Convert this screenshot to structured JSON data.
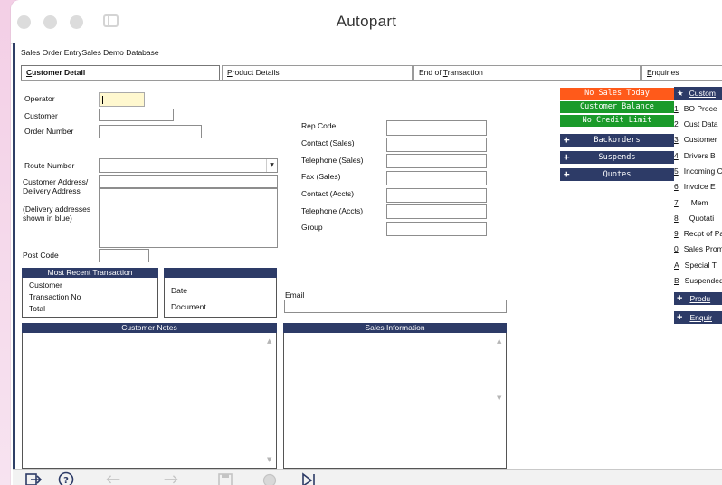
{
  "window": {
    "title": "Autopart"
  },
  "breadcrumb": {
    "text": "Sales Order EntrySales Demo Database"
  },
  "tabs": [
    {
      "label": "Customer Detail",
      "accel": "C",
      "rest": "ustomer Detail"
    },
    {
      "label": "Product Details",
      "pre": "",
      "accel": "P",
      "rest": "roduct Details"
    },
    {
      "label": "End of Transaction",
      "pre": "End of ",
      "accel": "T",
      "rest": "ransaction"
    },
    {
      "label": "Enquiries",
      "accel": "E",
      "rest": "nquiries"
    }
  ],
  "form": {
    "operator": "Operator",
    "customer": "Customer",
    "order_number": "Order Number",
    "route_number": "Route Number",
    "customer_address": "Customer Address/",
    "delivery_address": "Delivery Address",
    "delivery_note_1": "(Delivery addresses",
    "delivery_note_2": "shown in blue)",
    "post_code": "Post Code",
    "rep_code": "Rep Code",
    "contact_sales": "Contact (Sales)",
    "telephone_sales": "Telephone (Sales)",
    "fax_sales": "Fax (Sales)",
    "contact_accts": "Contact (Accts)",
    "telephone_accts": "Telephone (Accts)",
    "group": "Group",
    "email": "Email"
  },
  "recent": {
    "title": "Most Recent Transaction",
    "customer": "Customer",
    "transaction_no": "Transaction No",
    "total": "Total",
    "date": "Date",
    "document": "Document"
  },
  "panels": {
    "customer_notes": "Customer Notes",
    "sales_information": "Sales Information"
  },
  "status": {
    "no_sales": "No Sales Today",
    "customer_balance": "Customer Balance",
    "no_credit": "No Credit Limit"
  },
  "actions": {
    "backorders": "Backorders",
    "suspends": "Suspends",
    "quotes": "Quotes"
  },
  "right_nav": {
    "header": "Custom",
    "items": [
      {
        "key": "1",
        "label": "BO Proce"
      },
      {
        "key": "2",
        "label": "Cust Data"
      },
      {
        "key": "3",
        "label": "Customer"
      },
      {
        "key": "4",
        "label": "Drivers B"
      },
      {
        "key": "5",
        "label": "Incoming C"
      },
      {
        "key": "6",
        "label": "Invoice E"
      },
      {
        "key": "7",
        "label": "Mem"
      },
      {
        "key": "8",
        "label": "Quotati"
      },
      {
        "key": "9",
        "label": "Recpt of Pa"
      },
      {
        "key": "0",
        "label": "Sales Prom"
      },
      {
        "key": "A",
        "label": "Special T"
      },
      {
        "key": "B",
        "label": "Suspended"
      }
    ],
    "products": "Produ",
    "enquiries": "Enquir"
  },
  "colors": {
    "navy": "#2d3b67",
    "no_sales": "#ff5a1a",
    "green": "#1a9a2a",
    "operator_field": "#fff8cf"
  }
}
